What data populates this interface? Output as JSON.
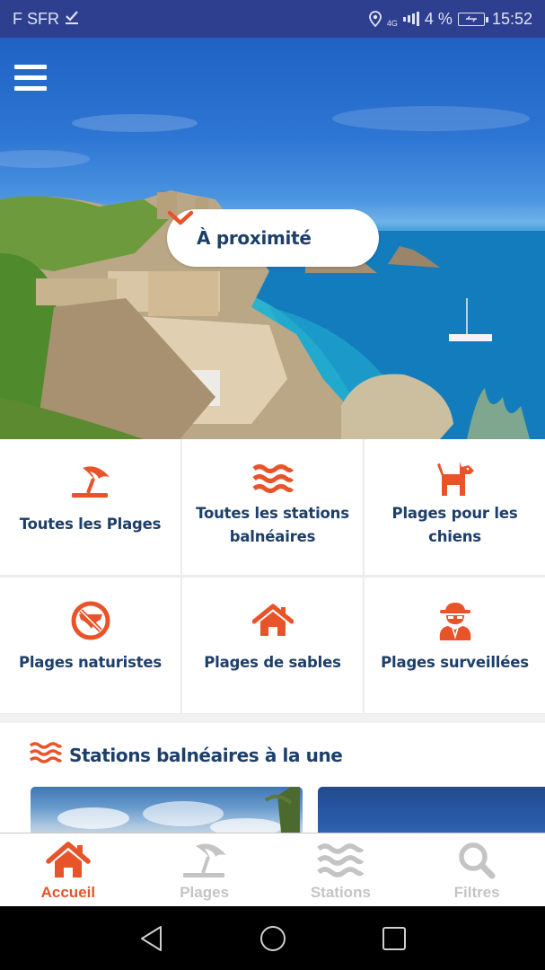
{
  "status_bar": {
    "carrier": "F SFR",
    "network": "4G",
    "battery": "4 %",
    "time": "15:52"
  },
  "hero": {
    "menu_icon": "hamburger-icon",
    "location_selector": {
      "label": "À proximité",
      "icon": "chevron-down-icon"
    }
  },
  "categories": [
    {
      "label": "Toutes les Plages",
      "icon": "beach-umbrella-icon"
    },
    {
      "label": "Toutes les stations balnéaires",
      "icon": "waves-icon"
    },
    {
      "label": "Plages pour les chiens",
      "icon": "dog-icon"
    },
    {
      "label": "Plages naturistes",
      "icon": "no-swimsuit-icon"
    },
    {
      "label": "Plages de sables",
      "icon": "home-icon"
    },
    {
      "label": "Plages surveillées",
      "icon": "spy-icon"
    }
  ],
  "featured": {
    "title": "Stations balnéaires à la une",
    "icon": "waves-icon"
  },
  "tabbar": {
    "tabs": [
      {
        "label": "Accueil",
        "icon": "home-icon",
        "active": true
      },
      {
        "label": "Plages",
        "icon": "beach-umbrella-icon",
        "active": false
      },
      {
        "label": "Stations",
        "icon": "waves-icon",
        "active": false
      },
      {
        "label": "Filtres",
        "icon": "search-icon",
        "active": false
      }
    ]
  },
  "colors": {
    "accent": "#e8542a",
    "text_primary": "#1d3f6b",
    "tab_inactive": "#c4c4c4",
    "status_bar": "#2f3f8f"
  }
}
